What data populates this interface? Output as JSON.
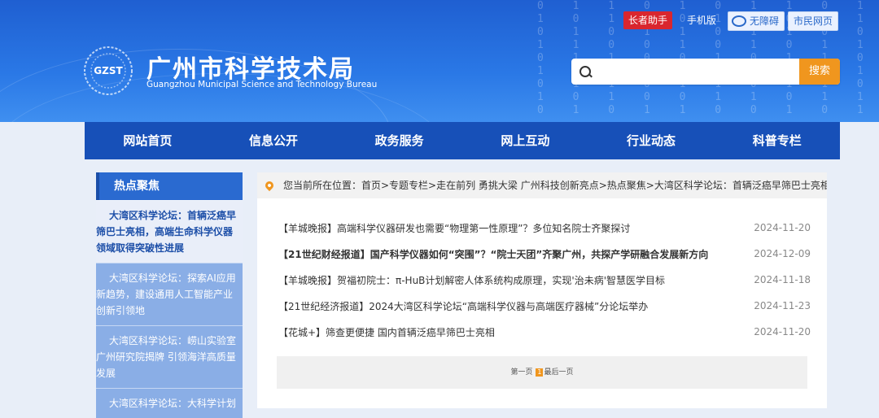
{
  "header": {
    "title": "广州市科学技术局",
    "subtitle": "Guangzhou Municipal Science and Technology Bureau",
    "logo_text": "GZST",
    "buttons": {
      "elder": "长者助手",
      "mobile": "手机版",
      "accessible": "无障碍",
      "citizen": "市民网页"
    },
    "search_button": "搜索",
    "search_placeholder": ""
  },
  "nav": [
    "网站首页",
    "信息公开",
    "政务服务",
    "网上互动",
    "行业动态",
    "科普专栏"
  ],
  "sidebar": {
    "heading": "热点聚焦",
    "items": [
      "大湾区科学论坛：首辆泛癌早筛巴士亮相，高端生命科学仪器领域取得突破性进展",
      "大湾区科学论坛：探索AI应用新趋势，建设通用人工智能产业创新引领地",
      "大湾区科学论坛：崂山实验室广州研究院揭牌 引领海洋高质量发展",
      "大湾区科学论坛：大科学计划"
    ]
  },
  "breadcrumb": "您当前所在位置：首页>专题专栏>走在前列 勇挑大梁 广州科技创新亮点>热点聚焦>大湾区科学论坛：首辆泛癌早筛巴士亮相，高",
  "news": [
    {
      "title": "【羊城晚报】高端科学仪器研发也需要“物理第一性原理”？多位知名院士齐聚探讨",
      "date": "2024-11-20"
    },
    {
      "title": "【21世纪财经报道】国产科学仪器如何“突围”？“院士天团”齐聚广州，共探产学研融合发展新方向",
      "date": "2024-12-09"
    },
    {
      "title": "【羊城晚报】贺福初院士：π-HuB计划解密人体系统构成原理，实现'治未病'智慧医学目标",
      "date": "2024-11-18"
    },
    {
      "title": "【21世纪经济报道】2024大湾区科学论坛“高端科学仪器与高端医疗器械”分论坛举办",
      "date": "2024-11-23"
    },
    {
      "title": "【花城+】筛查更便捷 国内首辆泛癌早筛巴士亮相",
      "date": "2024-11-20"
    }
  ],
  "pager": {
    "first": "第一页",
    "current": "1",
    "last": "最后一页"
  }
}
